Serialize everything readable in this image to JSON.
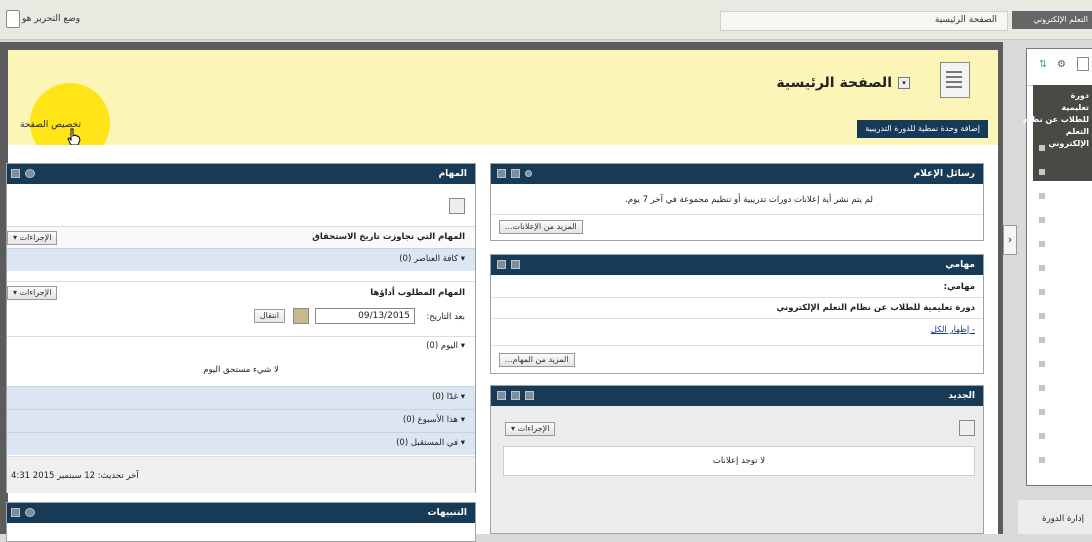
{
  "topbar": {
    "edit_mode_label": "وضع التحرير هو",
    "breadcrumb": "الصفحة الرئيسية",
    "course_button": "التعلم الإلكتروني"
  },
  "page": {
    "title": "الصفحة الرئيسية",
    "add_module_button": "إضافة وحدة نمطية للدورة التدريبية",
    "customize_page": "تخصيص الصفحة"
  },
  "announcements": {
    "title": "رسائل الإعلام",
    "message": "لم يتم نشر أية إعلانات دورات تدريبية أو تنظيم مجموعة في آخر 7 يوم.",
    "more_button": "المزيد من الإعلانات..."
  },
  "my_tasks": {
    "title": "مهامي",
    "label": "مهامي:",
    "course_line": "دورة تعليمية للطلاب عن نظام التعلم الإلكتروني",
    "view_all": "- إظهار الكل",
    "more_button": "المزيد من المهام..."
  },
  "whats_new": {
    "title": "الجديد",
    "actions_button": "الإجراءات",
    "empty": "لا توجد إعلانات"
  },
  "tasks": {
    "title": "المهام",
    "section1_title": "المهام التي تجاوزت تاريخ الاستحقاق",
    "actions_button": "الإجراءات",
    "all_items": "▾ كافة العناصر (0)",
    "section2_title": "المهام المطلوب أداؤها",
    "date_label": "بعد التاريخ:",
    "date_value": "09/13/2015",
    "go_button": "انتقال",
    "today": "▾ اليوم (0)",
    "nothing_due": "لا شيء مستحق اليوم",
    "tomorrow": "▾ غدًا (0)",
    "this_week": "▾ هذا الأسبوع (0)",
    "future": "▾ في المستقبل (0)",
    "last_updated": "آخر تحديث: 12 سبتمبر 2015 4:31"
  },
  "alerts": {
    "title": "التنبيهات"
  },
  "sidebar": {
    "dark_lines": [
      "دورة",
      "تعليمية",
      "للطلاب عن نظام",
      "التعلم",
      "الإلكتروني"
    ],
    "bottom_label": "إدارة الدورة"
  }
}
